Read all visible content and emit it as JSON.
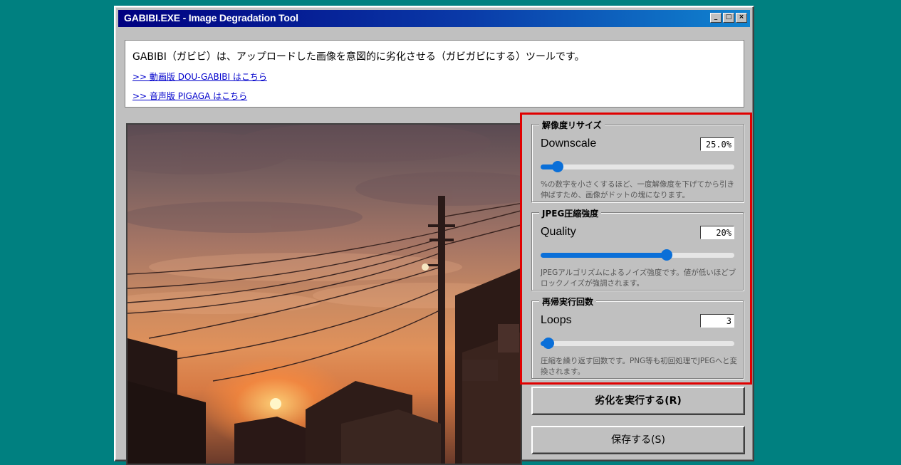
{
  "window": {
    "title": "GABIBI.EXE - Image Degradation Tool",
    "controls": [
      "_",
      "□",
      "×"
    ]
  },
  "intro": {
    "description": "GABIBI（ガビビ）は、アップロードした画像を意図的に劣化させる（ガビガビにする）ツールです。",
    "links": [
      ">> 動画版 DOU-GABIBI はこちら",
      ">> 音声版 PIGAGA はこちら"
    ]
  },
  "preview": {
    "alt": "sunset-photo"
  },
  "settings": {
    "groups": [
      {
        "legend": "解像度リサイズ",
        "label": "Downscale",
        "value": "25.0%",
        "level": 0.09,
        "help": "%の数字を小さくするほど、一度解像度を下げてから引き伸ばすため、画像がドットの塊になります。"
      },
      {
        "legend": "JPEG圧縮強度",
        "label": "Quality",
        "value": "20%",
        "level": 0.65,
        "help": "JPEGアルゴリズムによるノイズ強度です。値が低いほどブロックノイズが強調されます。"
      },
      {
        "legend": "再帰実行回数",
        "label": "Loops",
        "value": "3",
        "level": 0.04,
        "help": "圧縮を繰り返す回数です。PNG等も初回処理でJPEGへと変換されます。"
      }
    ]
  },
  "buttons": {
    "execute": "劣化を実行する(R)",
    "save": "保存する(S)"
  },
  "colors": {
    "desktop": "#008080",
    "highlight": "#e00000",
    "slider": "#0a6fd8",
    "link": "#0000cc"
  }
}
